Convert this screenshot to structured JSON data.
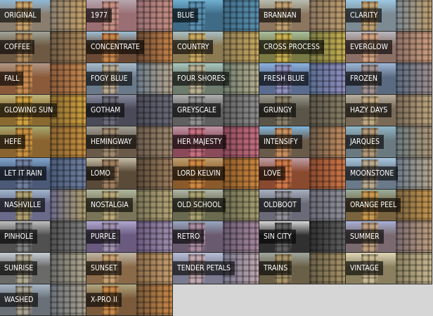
{
  "filters": [
    {
      "label": "ORIGINAL",
      "tint": "#8a7f6f",
      "sky": "#8fb8d8",
      "accent": "#c9a26a"
    },
    {
      "label": "1977",
      "tint": "#9a6f73",
      "sky": "#b7a7b0",
      "accent": "#c68f84"
    },
    {
      "label": "BLUE",
      "tint": "#3f6b86",
      "sky": "#6fb0d0",
      "accent": "#5a90b0"
    },
    {
      "label": "BRANNAN",
      "tint": "#8c7660",
      "sky": "#b6bcb0",
      "accent": "#c0a070"
    },
    {
      "label": "CLARITY",
      "tint": "#7c8a94",
      "sky": "#9cc8e2",
      "accent": "#c0a070"
    },
    {
      "label": "COFFEE",
      "tint": "#6e5a44",
      "sky": "#a0a59a",
      "accent": "#b08a5a"
    },
    {
      "label": "CONCENTRATE",
      "tint": "#6a4a35",
      "sky": "#9ec0d8",
      "accent": "#c8854a"
    },
    {
      "label": "COUNTRY",
      "tint": "#8c7a52",
      "sky": "#a8c0c8",
      "accent": "#c8a860"
    },
    {
      "label": "CROSS PROCESS",
      "tint": "#7a7a45",
      "sky": "#a8c0a0",
      "accent": "#c8b050"
    },
    {
      "label": "EVERGLOW",
      "tint": "#8c7066",
      "sky": "#b8b8c0",
      "accent": "#d0a080"
    },
    {
      "label": "FALL",
      "tint": "#8a5a3a",
      "sky": "#b09888",
      "accent": "#c88a50"
    },
    {
      "label": "FOGY BLUE",
      "tint": "#6a7a8a",
      "sky": "#a8bccc",
      "accent": "#b8a890"
    },
    {
      "label": "FOUR SHORES",
      "tint": "#6e7c6e",
      "sky": "#a8c8c0",
      "accent": "#b8b090"
    },
    {
      "label": "FRESH BLUE",
      "tint": "#5a6c90",
      "sky": "#8cb4e0",
      "accent": "#9090c0"
    },
    {
      "label": "FROZEN",
      "tint": "#5a6a80",
      "sky": "#a0b8d8",
      "accent": "#a09090"
    },
    {
      "label": "GLOWING SUN",
      "tint": "#8a6a30",
      "sky": "#c0b880",
      "accent": "#d0a040"
    },
    {
      "label": "GOTHAM",
      "tint": "#4a4a58",
      "sky": "#8a8ca0",
      "accent": "#6a6a78"
    },
    {
      "label": "GREYSCALE",
      "tint": "#606060",
      "sky": "#b0b0b0",
      "accent": "#909090"
    },
    {
      "label": "GRUNGY",
      "tint": "#5a5548",
      "sky": "#9a9a90",
      "accent": "#8a8068"
    },
    {
      "label": "HAZY DAYS",
      "tint": "#7a6a58",
      "sky": "#b8b0a0",
      "accent": "#c0a880"
    },
    {
      "label": "HEFE",
      "tint": "#8a6430",
      "sky": "#a8a870",
      "accent": "#c89040"
    },
    {
      "label": "HEMINGWAY",
      "tint": "#6a5a4a",
      "sky": "#a0a098",
      "accent": "#a08a70"
    },
    {
      "label": "HER MAJESTY",
      "tint": "#8a4a5a",
      "sky": "#c098a8",
      "accent": "#c87080"
    },
    {
      "label": "INTENSIFY",
      "tint": "#6a5a4a",
      "sky": "#80b8e0",
      "accent": "#c89060"
    },
    {
      "label": "JARQUES",
      "tint": "#6a7a80",
      "sky": "#90b8c8",
      "accent": "#b09878"
    },
    {
      "label": "LET IT RAIN",
      "tint": "#4a5a78",
      "sky": "#80a8d0",
      "accent": "#7080a0"
    },
    {
      "label": "LOMO",
      "tint": "#5a4a38",
      "sky": "#c8c0a8",
      "accent": "#a08060"
    },
    {
      "label": "LORD KELVIN",
      "tint": "#8a5a2a",
      "sky": "#c0a070",
      "accent": "#d08840"
    },
    {
      "label": "LOVE",
      "tint": "#8a4a30",
      "sky": "#c0a0a8",
      "accent": "#d07848"
    },
    {
      "label": "MOONSTONE",
      "tint": "#6a7a8a",
      "sky": "#a8c8e0",
      "accent": "#b8a890"
    },
    {
      "label": "NASHVILLE",
      "tint": "#6a6a8a",
      "sky": "#a0b8d0",
      "accent": "#b0a070"
    },
    {
      "label": "NOSTALGIA",
      "tint": "#7a7458",
      "sky": "#b0b8a0",
      "accent": "#b8a878"
    },
    {
      "label": "OLD SCHOOL",
      "tint": "#6a6a50",
      "sky": "#b0b8a8",
      "accent": "#a8a070"
    },
    {
      "label": "OLDBOOT",
      "tint": "#6a6a78",
      "sky": "#a8b0c0",
      "accent": "#909098"
    },
    {
      "label": "ORANGE PEEL",
      "tint": "#7a6440",
      "sky": "#98b0a0",
      "accent": "#c89850"
    },
    {
      "label": "PINHOLE",
      "tint": "#505050",
      "sky": "#c0c0c0",
      "accent": "#808080"
    },
    {
      "label": "PURPLE",
      "tint": "#6a5a80",
      "sky": "#b0a8d0",
      "accent": "#a090b0"
    },
    {
      "label": "RETRO",
      "tint": "#6a5a70",
      "sky": "#98a8c0",
      "accent": "#a88aa0"
    },
    {
      "label": "SIN CITY",
      "tint": "#303030",
      "sky": "#d8d8d8",
      "accent": "#606060"
    },
    {
      "label": "SUMMER",
      "tint": "#7a6a70",
      "sky": "#a8b0d8",
      "accent": "#c0a080"
    },
    {
      "label": "SUNRISE",
      "tint": "#6a6a68",
      "sky": "#c8d0d8",
      "accent": "#b0a890"
    },
    {
      "label": "SUNSET",
      "tint": "#8a6a48",
      "sky": "#c0b8a8",
      "accent": "#c8a070"
    },
    {
      "label": "TENDER PETALS",
      "tint": "#7a7a90",
      "sky": "#b8c0d8",
      "accent": "#c0a8b0"
    },
    {
      "label": "TRAINS",
      "tint": "#6a6048",
      "sky": "#a0a8a0",
      "accent": "#a89468"
    },
    {
      "label": "VINTAGE",
      "tint": "#8a8060",
      "sky": "#e0d8b8",
      "accent": "#c8b890"
    },
    {
      "label": "WASHED",
      "tint": "#6a7078",
      "sky": "#a8b8c8",
      "accent": "#a8a090"
    },
    {
      "label": "X-PRO II",
      "tint": "#7a5a3a",
      "sky": "#b0a880",
      "accent": "#c88848"
    }
  ]
}
